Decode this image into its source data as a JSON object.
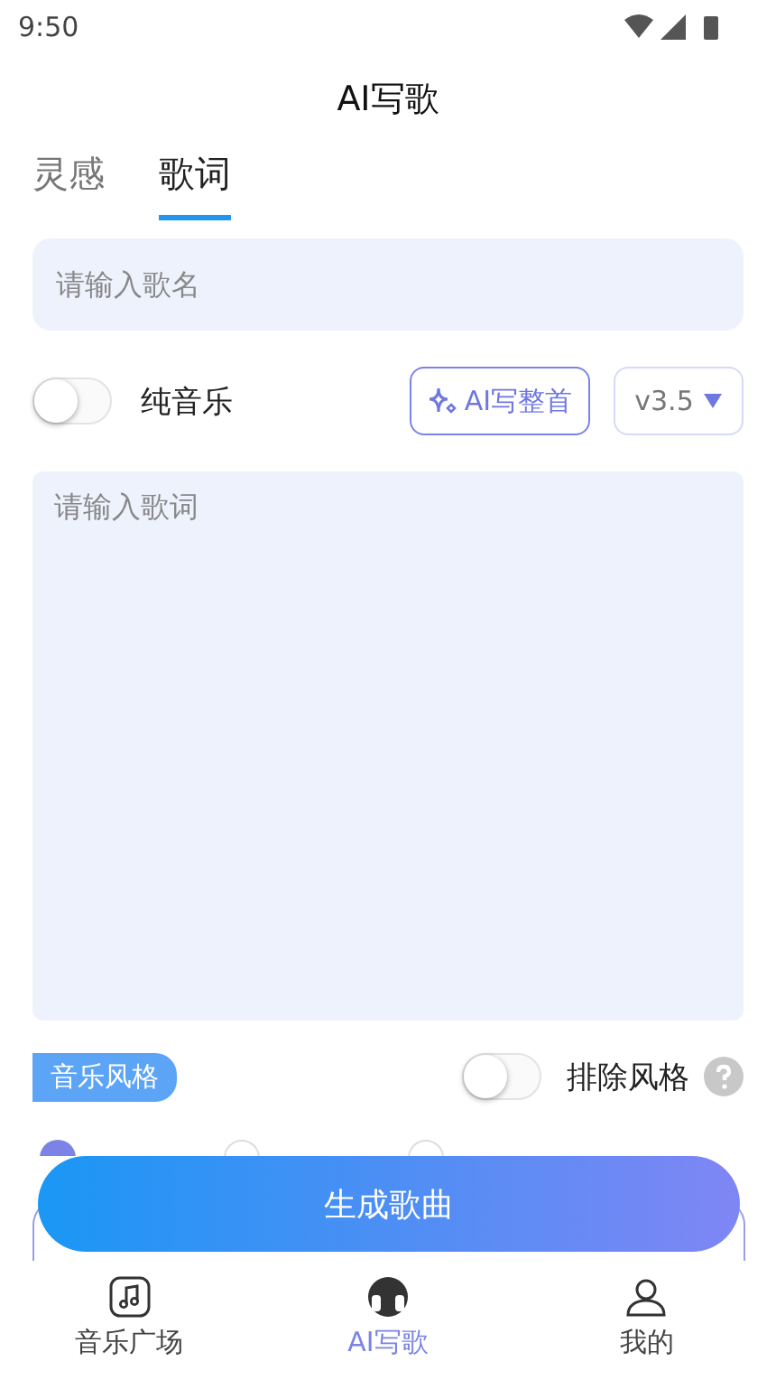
{
  "status_bar": {
    "time": "9:50"
  },
  "title": "AI写歌",
  "tabs": [
    {
      "label": "灵感",
      "selected": false
    },
    {
      "label": "歌词",
      "selected": true
    }
  ],
  "song_name": {
    "placeholder": "请输入歌名"
  },
  "pure_music": {
    "label": "纯音乐",
    "on": false
  },
  "ai_write_button": "AI写整首",
  "version": "v3.5",
  "lyrics": {
    "placeholder": "请输入歌词"
  },
  "style_tag": "音乐风格",
  "exclude_style": {
    "label": "排除风格",
    "on": false
  },
  "voice_options": [
    {
      "selected": true
    },
    {
      "selected": false
    },
    {
      "selected": false
    }
  ],
  "generate_button": "生成歌曲",
  "nav": [
    {
      "label": "音乐广场",
      "kind": "music",
      "selected": false
    },
    {
      "label": "AI写歌",
      "kind": "ai",
      "selected": true
    },
    {
      "label": "我的",
      "kind": "profile",
      "selected": false
    }
  ]
}
